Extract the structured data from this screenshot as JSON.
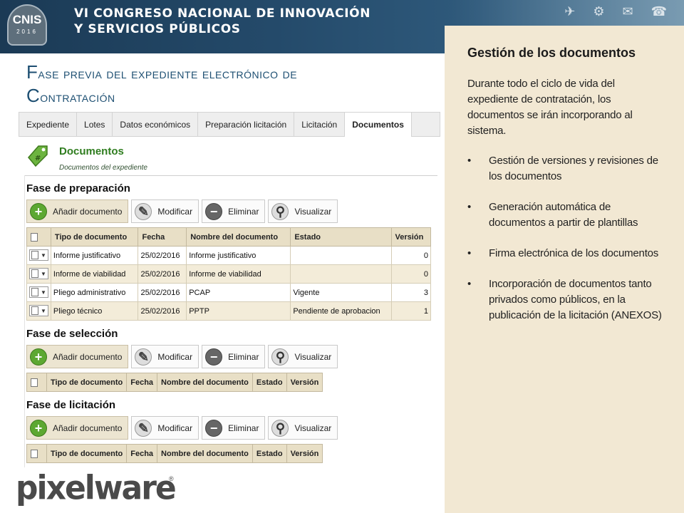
{
  "banner": {
    "logo_text": "CNIS",
    "logo_year": "2016",
    "title_line1": "VI CONGRESO NACIONAL DE INNOVACIÓN",
    "title_line2": "Y SERVICIOS PÚBLICOS"
  },
  "slide_title": {
    "w1_cap": "F",
    "w1_rest": "ase previa",
    "w2": " del expediente electrónico de",
    "w3_cap": "C",
    "w3_rest": "ontratación"
  },
  "tabs": [
    "Expediente",
    "Lotes",
    "Datos económicos",
    "Preparación licitación",
    "Licitación",
    "Documentos"
  ],
  "section": {
    "title": "Documentos",
    "subtitle": "Documentos del expediente"
  },
  "buttons": {
    "add": "Añadir documento",
    "edit": "Modificar",
    "delete": "Eliminar",
    "view": "Visualizar"
  },
  "columns": [
    "Tipo de documento",
    "Fecha",
    "Nombre del documento",
    "Estado",
    "Versión"
  ],
  "phases": {
    "preparacion": {
      "title": "Fase de preparación",
      "rows": [
        {
          "tipo": "Informe justificativo",
          "fecha": "25/02/2016",
          "nombre": "Informe justificativo",
          "estado": "",
          "version": "0"
        },
        {
          "tipo": "Informe de viabilidad",
          "fecha": "25/02/2016",
          "nombre": "Informe de viabilidad",
          "estado": "",
          "version": "0"
        },
        {
          "tipo": "Pliego administrativo",
          "fecha": "25/02/2016",
          "nombre": "PCAP",
          "estado": "Vigente",
          "version": "3"
        },
        {
          "tipo": "Pliego técnico",
          "fecha": "25/02/2016",
          "nombre": "PPTP",
          "estado": "Pendiente de aprobacion",
          "version": "1"
        }
      ]
    },
    "seleccion": {
      "title": "Fase de selección"
    },
    "licitacion": {
      "title": "Fase de licitación"
    }
  },
  "right_panel": {
    "title": "Gestión de los documentos",
    "intro": "Durante todo el ciclo de vida del expediente de contratación, los documentos se irán incorporando al sistema.",
    "bullets": [
      "Gestión de versiones y revisiones de los documentos",
      "Generación automática de documentos a partir de plantillas",
      "Firma electrónica de los documentos",
      "Incorporación de documentos tanto privados como públicos, en la publicación de la licitación (ANEXOS)"
    ]
  },
  "footer": {
    "logo": "pixelware",
    "reg": "®"
  },
  "icons": [
    "document-icon",
    "tag-icon",
    "plus-icon",
    "pencil-icon",
    "minus-icon",
    "magnifier-icon",
    "caret-down-icon"
  ]
}
